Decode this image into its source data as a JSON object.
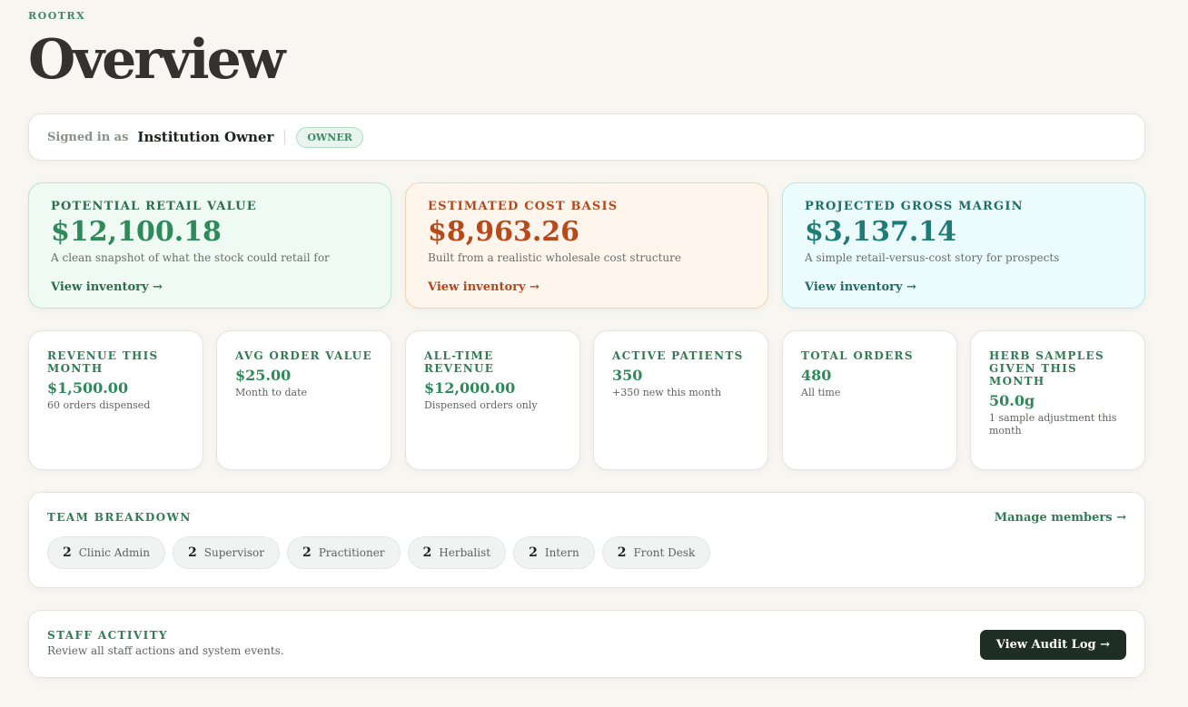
{
  "brand": "ROOTRX",
  "page_title": "Overview",
  "signin": {
    "label": "Signed in as",
    "name": "Institution Owner",
    "role_badge": "OWNER"
  },
  "kpis": [
    {
      "label": "POTENTIAL RETAIL VALUE",
      "value": "$12,100.18",
      "sub": "A clean snapshot of what the stock could retail for",
      "link": "View inventory →",
      "color": "#2f8a5a"
    },
    {
      "label": "ESTIMATED COST BASIS",
      "value": "$8,963.26",
      "sub": "Built from a realistic wholesale cost structure",
      "link": "View inventory →",
      "color": "#b8491a"
    },
    {
      "label": "PROJECTED GROSS MARGIN",
      "value": "$3,137.14",
      "sub": "A simple retail-versus-cost story for prospects",
      "link": "View inventory →",
      "color": "#1e7b76"
    }
  ],
  "stats": [
    {
      "label": "REVENUE THIS MONTH",
      "value": "$1,500.00",
      "sub": "60 orders dispensed"
    },
    {
      "label": "AVG ORDER VALUE",
      "value": "$25.00",
      "sub": "Month to date"
    },
    {
      "label": "ALL-TIME REVENUE",
      "value": "$12,000.00",
      "sub": "Dispensed orders only"
    },
    {
      "label": "ACTIVE PATIENTS",
      "value": "350",
      "sub": "+350 new this month"
    },
    {
      "label": "TOTAL ORDERS",
      "value": "480",
      "sub": "All time"
    },
    {
      "label": "HERB SAMPLES GIVEN THIS MONTH",
      "value": "50.0g",
      "sub": "1 sample adjustment this month"
    }
  ],
  "team": {
    "title": "TEAM BREAKDOWN",
    "manage_link": "Manage members →",
    "roles": [
      {
        "count": "2",
        "role": "Clinic Admin"
      },
      {
        "count": "2",
        "role": "Supervisor"
      },
      {
        "count": "2",
        "role": "Practitioner"
      },
      {
        "count": "2",
        "role": "Herbalist"
      },
      {
        "count": "2",
        "role": "Intern"
      },
      {
        "count": "2",
        "role": "Front Desk"
      }
    ]
  },
  "staff_activity": {
    "title": "STAFF ACTIVITY",
    "subtitle": "Review all staff actions and system events.",
    "button": "View Audit Log →"
  }
}
